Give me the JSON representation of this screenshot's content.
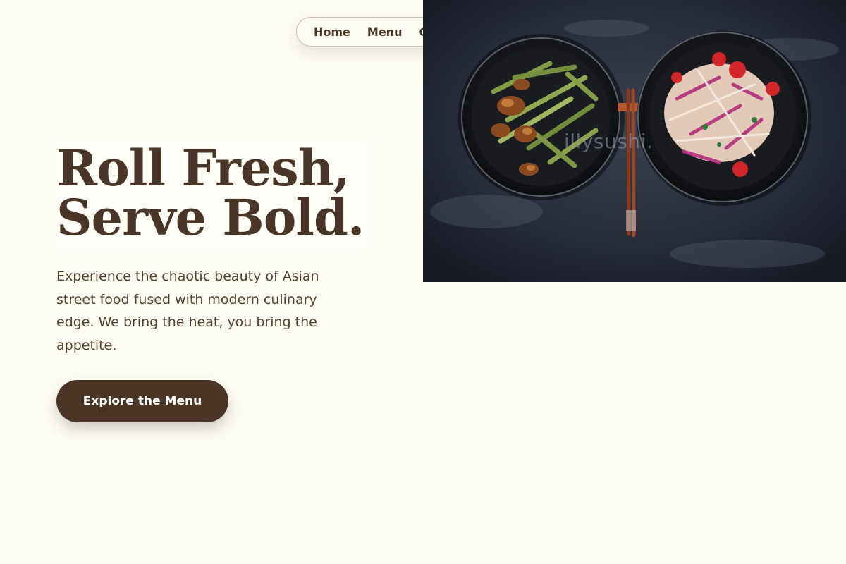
{
  "nav": {
    "items": [
      {
        "label": "Home"
      },
      {
        "label": "Menu"
      },
      {
        "label": "O"
      }
    ]
  },
  "hero": {
    "headline_line1": "Roll Fresh,",
    "headline_line2": "Serve Bold.",
    "description": "Experience the chaotic beauty of Asian street food fused with modern culinary edge. We bring the heat, you bring the appetite.",
    "cta_label": "Explore the Menu",
    "image": {
      "alt": "Two bowls of Asian dishes with chopsticks on a dark slate surface",
      "watermark": "illysushi."
    }
  },
  "colors": {
    "background": "#fdfcf4",
    "text_brown": "#4a3627",
    "button_brown": "#4b3526",
    "button_text": "#ffffff",
    "image_bg": "#1d2330"
  }
}
